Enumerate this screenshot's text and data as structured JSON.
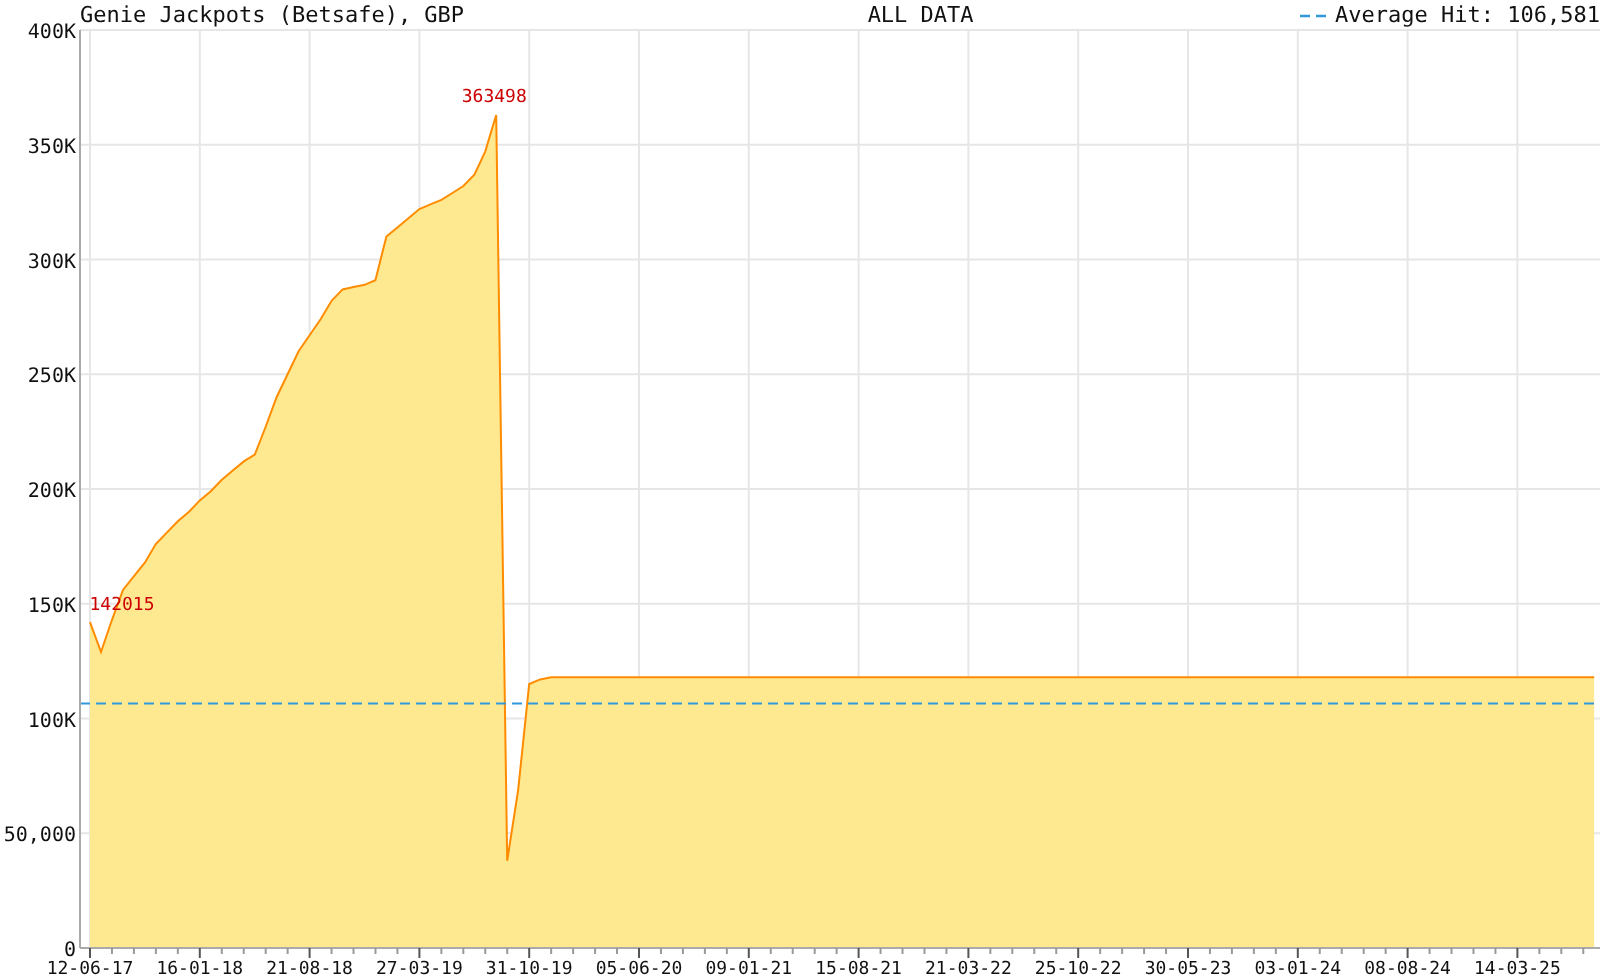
{
  "header": {
    "range": "ALL DATA"
  },
  "chart_data": {
    "type": "area",
    "title": "Genie Jackpots (Betsafe), GBP",
    "ylim": [
      0,
      400000
    ],
    "categories": [
      "12-06-17",
      null,
      null,
      null,
      null,
      null,
      null,
      null,
      null,
      null,
      "16-01-18",
      null,
      null,
      null,
      null,
      null,
      null,
      null,
      null,
      null,
      "21-08-18",
      null,
      null,
      null,
      null,
      null,
      null,
      null,
      null,
      null,
      "27-03-19",
      null,
      null,
      null,
      null,
      null,
      null,
      null,
      null,
      null,
      "31-10-19",
      null,
      null,
      null,
      null,
      null,
      null,
      null,
      null,
      null,
      "05-06-20",
      null,
      null,
      null,
      null,
      null,
      null,
      null,
      null,
      null,
      "09-01-21",
      null,
      null,
      null,
      null,
      null,
      null,
      null,
      null,
      null,
      "15-08-21",
      null,
      null,
      null,
      null,
      null,
      null,
      null,
      null,
      null,
      "21-03-22",
      null,
      null,
      null,
      null,
      null,
      null,
      null,
      null,
      null,
      "25-10-22",
      null,
      null,
      null,
      null,
      null,
      null,
      null,
      null,
      null,
      "30-05-23",
      null,
      null,
      null,
      null,
      null,
      null,
      null,
      null,
      null,
      "03-01-24",
      null,
      null,
      null,
      null,
      null,
      null,
      null,
      null,
      null,
      "08-08-24",
      null,
      null,
      null,
      null,
      null,
      null,
      null,
      null,
      null,
      "14-03-25",
      null,
      null,
      null,
      null,
      null,
      null,
      null
    ],
    "yticks": [
      {
        "value": 0,
        "label": "0"
      },
      {
        "value": 50000,
        "label": "50,000"
      },
      {
        "value": 100000,
        "label": "100K"
      },
      {
        "value": 150000,
        "label": "150K"
      },
      {
        "value": 200000,
        "label": "200K"
      },
      {
        "value": 250000,
        "label": "250K"
      },
      {
        "value": 300000,
        "label": "300K"
      },
      {
        "value": 350000,
        "label": "350K"
      },
      {
        "value": 400000,
        "label": "400K"
      }
    ],
    "series": [
      {
        "color": "#ff8c00",
        "values": [
          142000,
          129000,
          143000,
          156000,
          162000,
          168000,
          176000,
          181000,
          186000,
          190000,
          195000,
          199000,
          204000,
          208000,
          212000,
          215000,
          227000,
          240000,
          250000,
          260000,
          267000,
          274000,
          282000,
          287000,
          288000,
          289000,
          291000,
          310000,
          314000,
          318000,
          322000,
          324000,
          326000,
          329000,
          332000,
          337000,
          347000,
          363000,
          38000,
          69000,
          115000,
          117000,
          118000,
          118000,
          118000,
          118000,
          118000,
          118000,
          118000,
          118000,
          118000,
          118000,
          118000,
          118000,
          118000,
          118000,
          118000,
          118000,
          118000,
          118000,
          118000,
          118000,
          118000,
          118000,
          118000,
          118000,
          118000,
          118000,
          118000,
          118000,
          118000,
          118000,
          118000,
          118000,
          118000,
          118000,
          118000,
          118000,
          118000,
          118000,
          118000,
          118000,
          118000,
          118000,
          118000,
          118000,
          118000,
          118000,
          118000,
          118000,
          118000,
          118000,
          118000,
          118000,
          118000,
          118000,
          118000,
          118000,
          118000,
          118000,
          118000,
          118000,
          118000,
          118000,
          118000,
          118000,
          118000,
          118000,
          118000,
          118000,
          118000,
          118000,
          118000,
          118000,
          118000,
          118000,
          118000,
          118000,
          118000,
          118000,
          118000,
          118000,
          118000,
          118000,
          118000,
          118000,
          118000,
          118000,
          118000,
          118000,
          118000,
          118000,
          118000,
          118000,
          118000,
          118000,
          118000,
          118000
        ]
      }
    ],
    "grid": true,
    "ref_lines": [
      {
        "axis": "y",
        "value": 106581,
        "label": "Average Hit: 106,581",
        "color": "#3399dd"
      }
    ],
    "annotations": [
      {
        "y": 363498,
        "text": "363498"
      },
      {
        "y": 142015,
        "text": "142015"
      }
    ]
  }
}
